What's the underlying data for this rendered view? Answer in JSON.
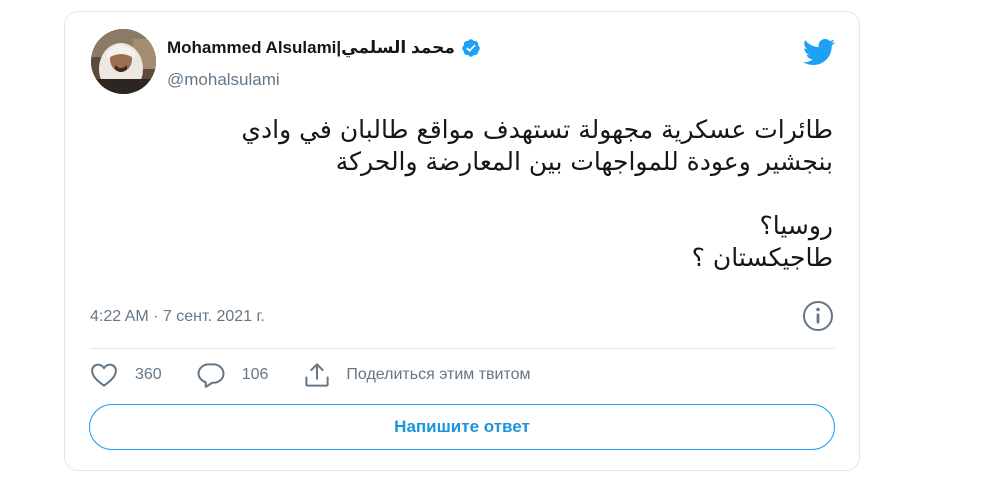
{
  "author": {
    "display_name": "Mohammed Alsulami|محمد السلمي",
    "handle": "@mohalsulami",
    "verified_icon": "verified-badge-icon"
  },
  "tweet": {
    "lines": [
      "طائرات عسكرية مجهولة تستهدف مواقع طالبان في وادي",
      "بنجشير وعودة للمواجهات بين المعارضة والحركة",
      "",
      "روسيا؟",
      "طاجيكستان ؟"
    ],
    "timestamp": "4:22 AM · 7 сент. 2021 г."
  },
  "actions": {
    "likes": "360",
    "replies": "106",
    "share_label": "Поделиться этим твитом"
  },
  "reply_button": {
    "label": "Напишите ответ"
  },
  "colors": {
    "accent": "#1da1f2",
    "text": "#14171a",
    "muted": "#657786",
    "border": "#e1e8ed"
  }
}
